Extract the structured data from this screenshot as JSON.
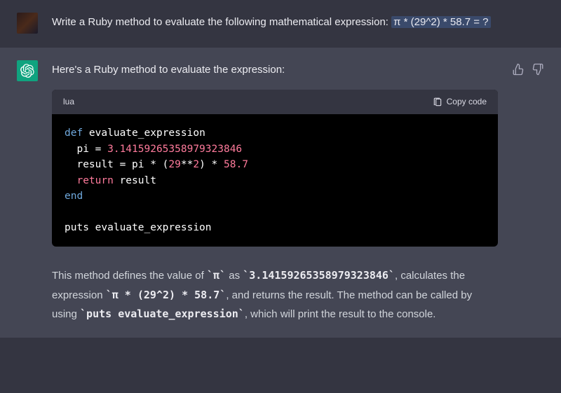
{
  "user_message": {
    "prefix": "Write a Ruby method to evaluate the following mathematical expression: ",
    "highlighted": " π * (29^2) * 58.7 = ? "
  },
  "assistant": {
    "intro": "Here's a Ruby method to evaluate the expression:",
    "code_lang": "lua",
    "copy_label": "Copy code",
    "code": {
      "l1_kw": "def",
      "l1_name": " evaluate_expression",
      "l2_a": "  pi = ",
      "l2_num": "3.14159265358979323846",
      "l3_a": "  result = pi * (",
      "l3_n1": "29",
      "l3_b": "**",
      "l3_n2": "2",
      "l3_c": ") * ",
      "l3_n3": "58.7",
      "l4_kw": "  return",
      "l4_rest": " result",
      "l5": "end",
      "l6": "",
      "l7": "puts evaluate_expression"
    },
    "explanation": {
      "p1a": "This method defines the value of ",
      "c1": "`π`",
      "p1b": " as ",
      "c2": "`3.14159265358979323846`",
      "p1c": ", calculates the expression ",
      "c3": "`π * (29^2) * 58.7`",
      "p1d": ", and returns the result. The method can be called by using ",
      "c4": "`puts evaluate_expression`",
      "p1e": ", which will print the result to the console."
    }
  }
}
